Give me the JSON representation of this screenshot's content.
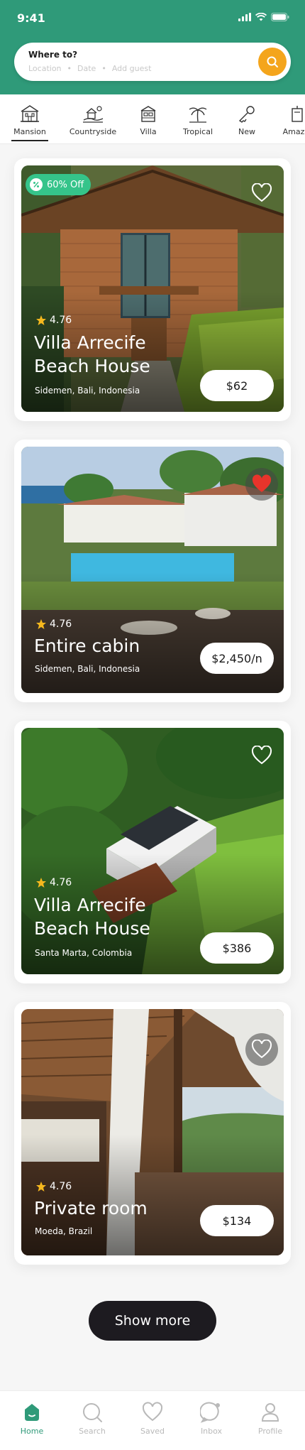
{
  "status_bar": {
    "time": "9:41"
  },
  "search": {
    "title": "Where to?",
    "location": "Location",
    "date": "Date",
    "guests": "Add guest",
    "button_color": "#f4a51c"
  },
  "theme": {
    "primary": "#2f9a79",
    "accent": "#f4a51c",
    "badge": "#35c48a",
    "heart_active": "#e8342b"
  },
  "categories": [
    {
      "label": "Mansion",
      "icon": "mansion-icon",
      "active": true
    },
    {
      "label": "Countryside",
      "icon": "countryside-icon",
      "active": false
    },
    {
      "label": "Villa",
      "icon": "villa-icon",
      "active": false
    },
    {
      "label": "Tropical",
      "icon": "palm-tree-icon",
      "active": false
    },
    {
      "label": "New",
      "icon": "key-icon",
      "active": false
    },
    {
      "label": "Amazin",
      "icon": "amazing-icon",
      "active": false
    }
  ],
  "listings": [
    {
      "badge": "60% Off",
      "rating": "4.76",
      "title": "Villa Arrecife Beach House",
      "location": "Sidemen, Bali, Indonesia",
      "price": "$62",
      "favorited": false,
      "image": "brick-cabin-photo"
    },
    {
      "badge": "",
      "rating": "4.76",
      "title": "Entire cabin",
      "location": "Sidemen, Bali, Indonesia",
      "price": "$2,450/n",
      "favorited": true,
      "image": "seaside-villa-photo"
    },
    {
      "badge": "",
      "rating": "4.76",
      "title": "Villa Arrecife Beach House",
      "location": "Santa Marta, Colombia",
      "price": "$386",
      "favorited": false,
      "image": "jungle-house-photo"
    },
    {
      "badge": "",
      "rating": "4.76",
      "title": "Private room",
      "location": "Moeda, Brazil",
      "price": "$134",
      "favorited": false,
      "image": "wooden-loft-photo"
    }
  ],
  "show_more": "Show more",
  "bottom_nav": [
    {
      "label": "Home",
      "icon": "home-icon",
      "active": true
    },
    {
      "label": "Search",
      "icon": "search-icon",
      "active": false
    },
    {
      "label": "Saved",
      "icon": "heart-icon",
      "active": false
    },
    {
      "label": "Inbox",
      "icon": "chat-icon",
      "active": false
    },
    {
      "label": "Profile",
      "icon": "profile-icon",
      "active": false
    }
  ]
}
